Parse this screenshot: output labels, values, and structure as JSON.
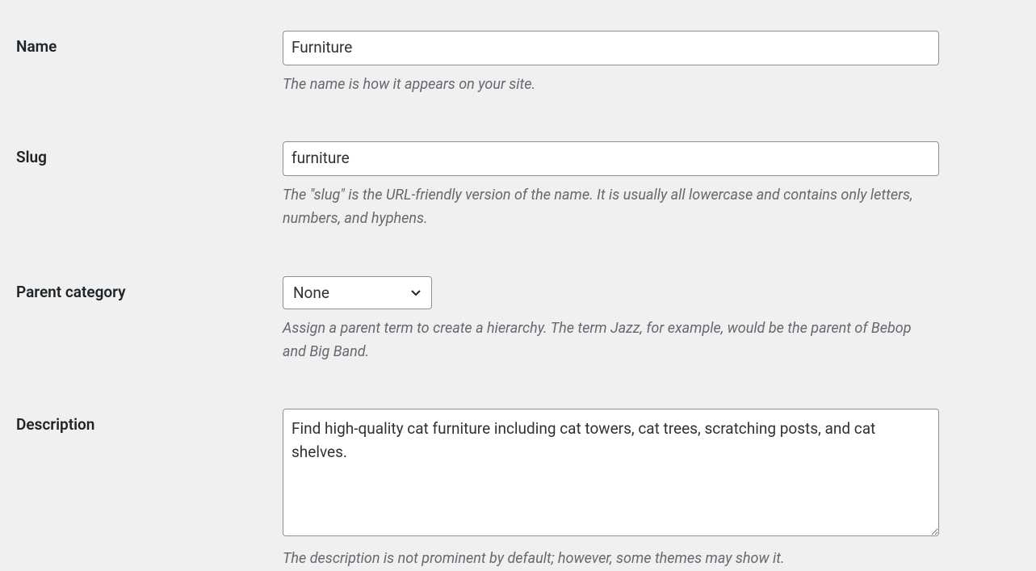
{
  "fields": {
    "name": {
      "label": "Name",
      "value": "Furniture",
      "description": "The name is how it appears on your site."
    },
    "slug": {
      "label": "Slug",
      "value": "furniture",
      "description": "The \"slug\" is the URL-friendly version of the name. It is usually all lowercase and contains only letters, numbers, and hyphens."
    },
    "parent": {
      "label": "Parent category",
      "selected": "None",
      "description": "Assign a parent term to create a hierarchy. The term Jazz, for example, would be the parent of Bebop and Big Band."
    },
    "description": {
      "label": "Description",
      "value": "Find high-quality cat furniture including cat towers, cat trees, scratching posts, and cat shelves.",
      "description": "The description is not prominent by default; however, some themes may show it."
    }
  }
}
